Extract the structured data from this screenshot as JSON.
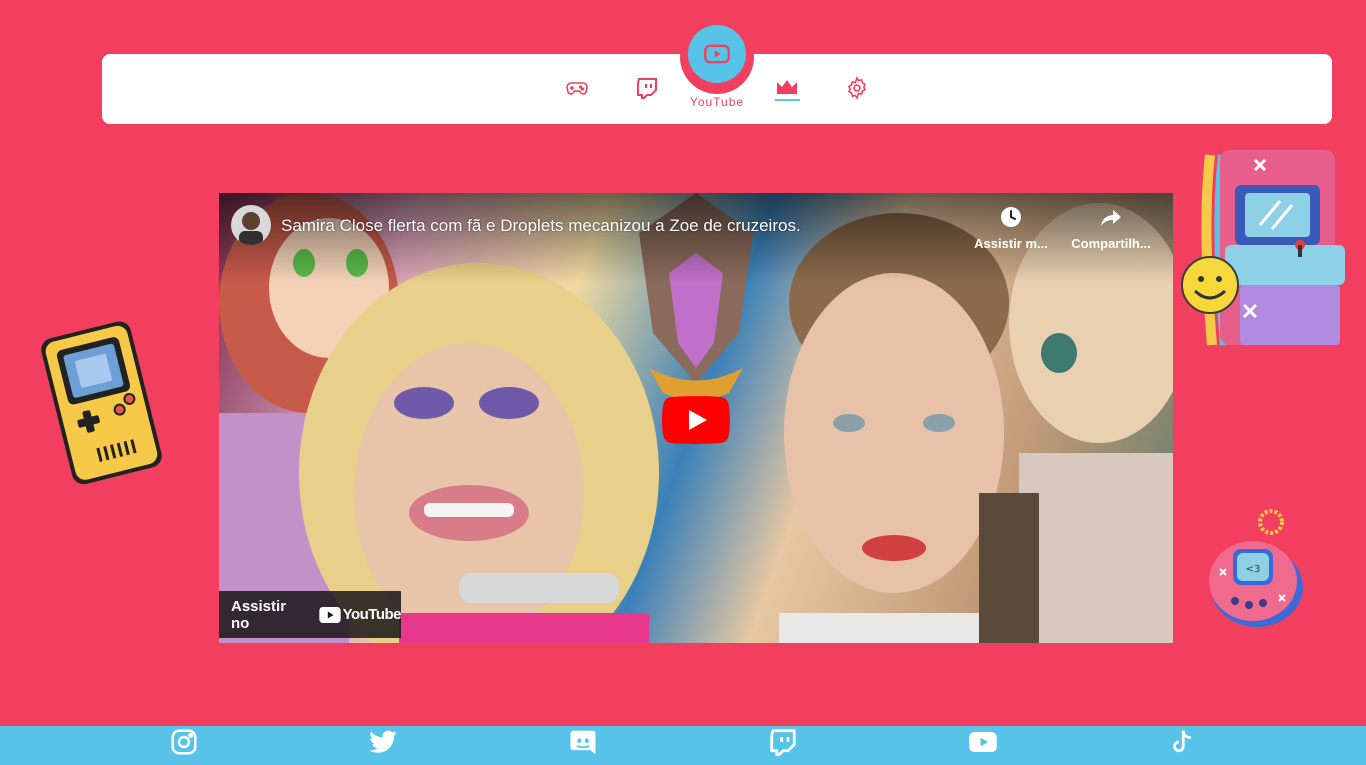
{
  "nav": {
    "items": [
      {
        "icon": "gamepad-icon"
      },
      {
        "icon": "twitch-icon"
      },
      {
        "icon": "youtube-icon",
        "label": "YouTube",
        "active": true
      },
      {
        "icon": "crown-icon"
      },
      {
        "icon": "gear-icon"
      }
    ],
    "active_label": "YouTube"
  },
  "player": {
    "title": "Samira Close flerta com fã e Droplets mecanizou a Zoe de cruzeiros.",
    "watch_later_label": "Assistir m...",
    "share_label": "Compartilh...",
    "watch_on_label": "Assistir no",
    "youtube_wordmark": "YouTube"
  },
  "footer": {
    "social": [
      "instagram-icon",
      "twitter-icon",
      "discord-icon",
      "twitch-icon",
      "youtube-icon",
      "tiktok-icon"
    ]
  },
  "colors": {
    "background": "#f33f5f",
    "accent_blue": "#58c3e9",
    "nav_icon": "#f33f5f",
    "youtube_red": "#ff0000"
  }
}
